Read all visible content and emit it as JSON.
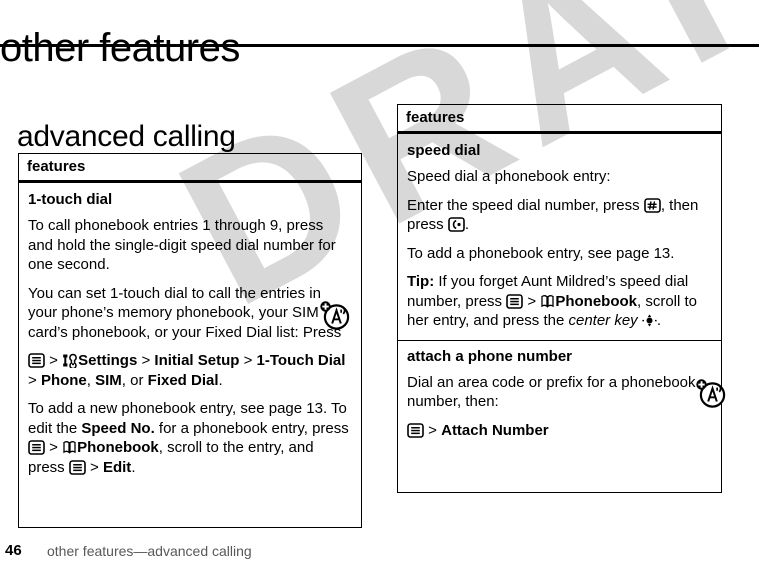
{
  "page": {
    "title": "other features",
    "section_title": "advanced calling",
    "watermark_text": "DRAFT",
    "watermark_color": "#d8d8d8"
  },
  "footer": {
    "page_number": "46",
    "breadcrumb": "other features—advanced calling"
  },
  "left_table": {
    "header": "features",
    "rows": [
      {
        "title": "1-touch dial",
        "paragraphs": [
          "To call phonebook entries 1 through 9, press and hold the single-digit speed dial number for one second.",
          "You can set 1-touch dial to call the entries in your phone’s memory phonebook, your SIM card’s phonebook, or your Fixed Dial list: Press",
          "To add a new phonebook entry, see page 13. To edit the",
          "for a phonebook entry, press"
        ],
        "menu_path": {
          "menu_key": "menu-key-icon",
          "sep": ">",
          "settings_icon": "settings-icon",
          "settings": "Settings",
          "initial_setup": "Initial Setup",
          "one_touch_dial": "1-Touch Dial",
          "phone": "Phone",
          "sim": "SIM",
          "or": "or",
          "fixed_dial": "Fixed Dial"
        },
        "edit_path": {
          "speed_no": "Speed No.",
          "phonebook_icon": "phonebook-icon",
          "phonebook": "Phonebook",
          "scroll_text": "scroll to the entry, and press",
          "edit": "Edit"
        }
      }
    ]
  },
  "right_table": {
    "header": "features",
    "rows": [
      {
        "title": "speed dial",
        "paragraphs": [
          "Speed dial a phonebook entry:",
          "Enter the speed dial number, press",
          "then press",
          "To add a phonebook entry, see page 13."
        ],
        "tip_label": "Tip:",
        "tip_text_1": "If you forget Aunt Mildred’s speed dial number, press",
        "tip_sep": ">",
        "tip_phonebook": "Phonebook",
        "tip_text_2": ", scroll to her entry, and press the",
        "tip_center_key": "center key",
        "keys": {
          "hash": "pound-key-icon",
          "send": "send-key-icon",
          "menu": "menu-key-icon",
          "center": "center-key-icon"
        }
      },
      {
        "title": "attach a phone number",
        "paragraphs": [
          "Dial an area code or prefix for a phonebook number, then:"
        ],
        "menu_path": {
          "menu_key": "menu-key-icon",
          "sep": ">",
          "attach_number": "Attach Number"
        }
      }
    ]
  },
  "margin_icons": {
    "left": "network-tip-icon",
    "right": "network-tip-icon"
  }
}
